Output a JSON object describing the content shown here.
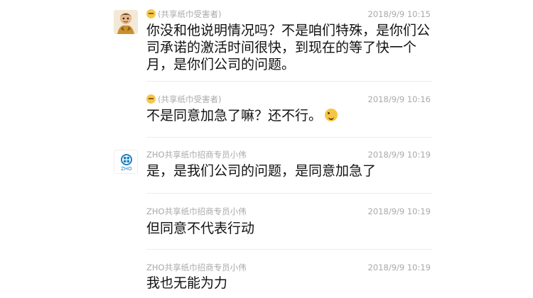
{
  "messages": [
    {
      "sender": "(共享纸巾受害者)",
      "time": "2018/9/9 10:15",
      "text": "你没和他说明情况吗？不是咱们特殊，是你们公司承诺的激活时间很快，到现在的等了快一个月，是你们公司的问题。",
      "avatar": "cartoon-avatar"
    },
    {
      "sender": "(共享纸巾受害者)",
      "time": "2018/9/9 10:16",
      "text": "不是同意加急了嘛？还不行。"
    },
    {
      "sender": "ZHO共享纸巾招商专员小伟",
      "time": "2018/9/9 10:19",
      "text": "是，是我们公司的问题，是同意加急了",
      "avatar": "zho-logo-avatar",
      "avatar_label": "ZHO"
    },
    {
      "sender": "ZHO共享纸巾招商专员小伟",
      "time": "2018/9/9 10:19",
      "text": "但同意不代表行动"
    },
    {
      "sender": "ZHO共享纸巾招商专员小伟",
      "time": "2018/9/9 10:19",
      "text": "我也无能为力"
    }
  ],
  "colors": {
    "meta": "#a9a9a9",
    "text": "#111111",
    "divider": "#ececec",
    "logo": "#1f7fc2"
  }
}
